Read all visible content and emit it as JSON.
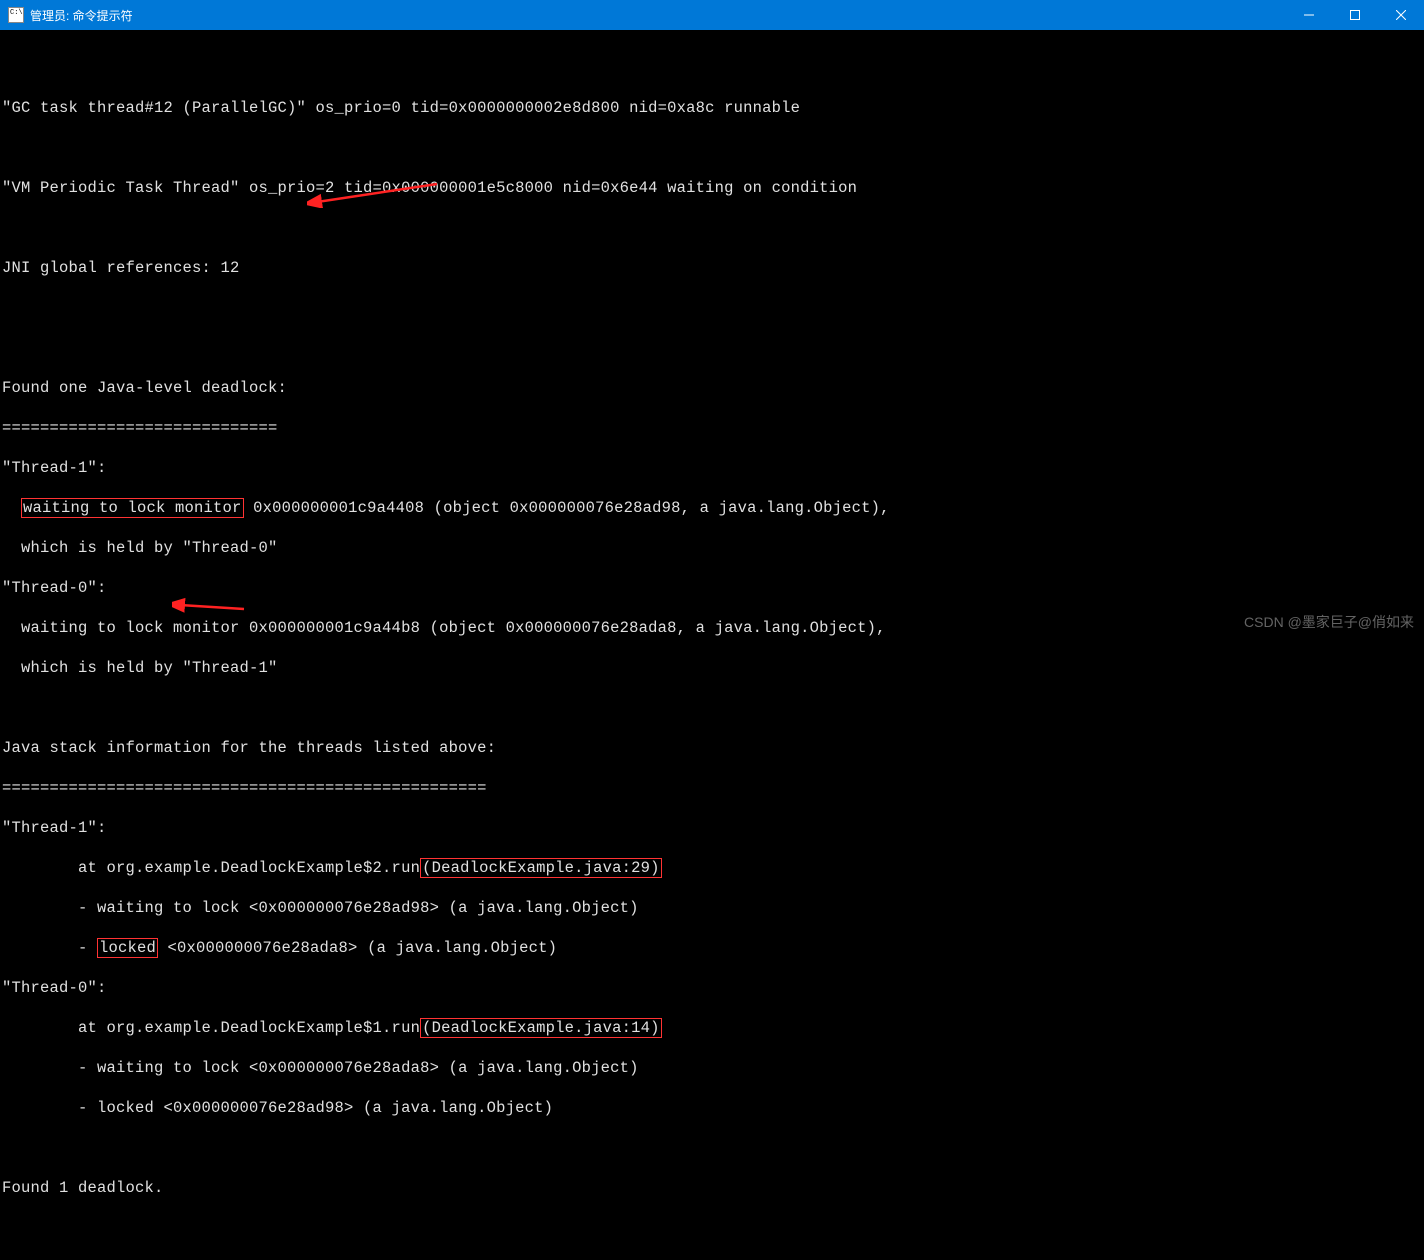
{
  "window": {
    "title": "管理员: 命令提示符"
  },
  "terminal": {
    "lines": [
      "",
      "\"GC task thread#12 (ParallelGC)\" os_prio=0 tid=0x0000000002e8d800 nid=0xa8c runnable",
      "",
      "\"VM Periodic Task Thread\" os_prio=2 tid=0x000000001e5c8000 nid=0x6e44 waiting on condition",
      "",
      "JNI global references: 12",
      "",
      "",
      "Found one Java-level deadlock:",
      "=============================",
      "\"Thread-1\":",
      "  waiting to lock monitor 0x000000001c9a4408 (object 0x000000076e28ad98, a java.lang.Object),",
      "  which is held by \"Thread-0\"",
      "\"Thread-0\":",
      "  waiting to lock monitor 0x000000001c9a44b8 (object 0x000000076e28ada8, a java.lang.Object),",
      "  which is held by \"Thread-1\"",
      "",
      "Java stack information for the threads listed above:",
      "===================================================",
      "\"Thread-1\":",
      "        at org.example.DeadlockExample$2.run(DeadlockExample.java:29)",
      "        - waiting to lock <0x000000076e28ad98> (a java.lang.Object)",
      "        - locked <0x000000076e28ada8> (a java.lang.Object)",
      "\"Thread-0\":",
      "        at org.example.DeadlockExample$1.run(DeadlockExample.java:14)",
      "        - waiting to lock <0x000000076e28ada8> (a java.lang.Object)",
      "        - locked <0x000000076e28ad98> (a java.lang.Object)",
      "",
      "Found 1 deadlock.",
      ""
    ],
    "highlights": {
      "box1_text": "waiting to lock monitor",
      "box2_text": "(DeadlockExample.java:29)",
      "box3_text": "locked",
      "box4_text": "(DeadlockExample.java:14)"
    }
  },
  "watermark": "CSDN @墨家巨子@俏如来",
  "annotations": {
    "arrow_color": "#ff2222"
  }
}
